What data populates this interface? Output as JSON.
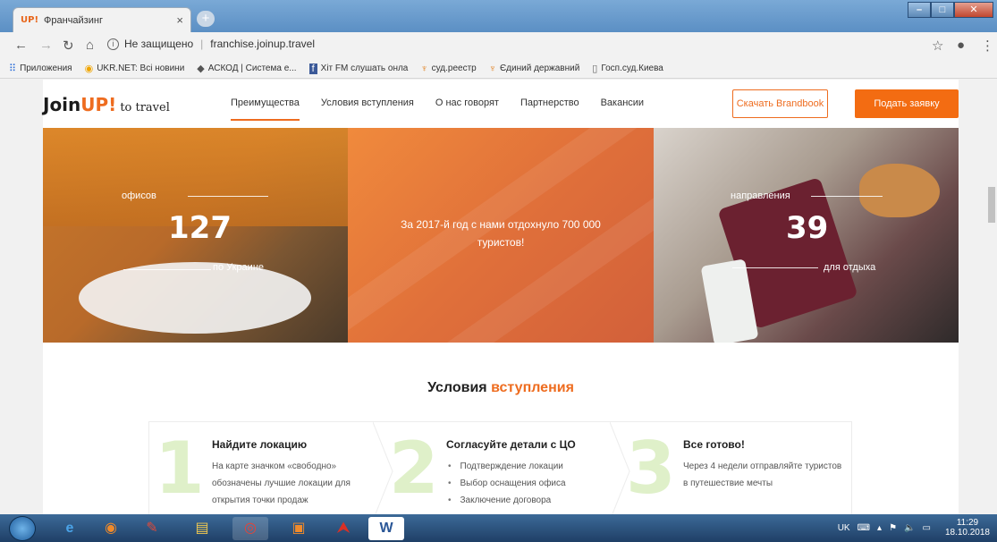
{
  "browser": {
    "tab_title": "Франчайзинг",
    "tab_favicon": "UP!",
    "tab_close": "×",
    "new_tab": "+",
    "url_security": "Не защищено",
    "url": "franchise.joinup.travel",
    "bookmarks": [
      {
        "label": "Приложения",
        "icon": "apps-icon"
      },
      {
        "label": "UKR.NET: Всі новини",
        "icon": "ukrnet-icon"
      },
      {
        "label": "АСКОД | Система е...",
        "icon": "askod-icon"
      },
      {
        "label": "Хіт FM слушать онла",
        "icon": "facebook-icon"
      },
      {
        "label": "суд.реестр",
        "icon": "trident-icon"
      },
      {
        "label": "Єдиний державний",
        "icon": "trident-icon"
      },
      {
        "label": "Госп.суд.Киева",
        "icon": "page-icon"
      }
    ]
  },
  "site": {
    "logo_join": "Join",
    "logo_up": "UP!",
    "logo_to": "to travel",
    "menu": [
      "Преимущества",
      "Условия вступления",
      "О нас говорят",
      "Партнерство",
      "Вакансии"
    ],
    "brandbook_button": "Скачать Brandbook",
    "apply_button": "Подать заявку"
  },
  "stats": {
    "offices_label": "офисов",
    "offices_number": "127",
    "offices_sub": "по Украине",
    "center_text": "За 2017-й год с нами отдохнуло 700 000 туристов!",
    "dest_label": "направления",
    "dest_number": "39",
    "dest_sub": "для отдыха"
  },
  "terms": {
    "title_main": "Условия",
    "title_accent": "вступления",
    "steps": [
      {
        "num": "1",
        "title": "Найдите локацию",
        "text": "На карте значком «свободно» обозначены лучшие локации для открытия точки продаж"
      },
      {
        "num": "2",
        "title": "Согласуйте детали с ЦО",
        "items": [
          "Подтверждение локации",
          "Выбор оснащения офиса",
          "Заключение договора"
        ]
      },
      {
        "num": "3",
        "title": "Все готово!",
        "text": "Через 4 недели отправляйте туристов в путешествие мечты"
      }
    ]
  },
  "taskbar": {
    "lang": "UK",
    "time": "11:29",
    "date": "18.10.2018"
  },
  "colors": {
    "accent": "#ee6c1f",
    "step_number": "#dff0c9"
  }
}
